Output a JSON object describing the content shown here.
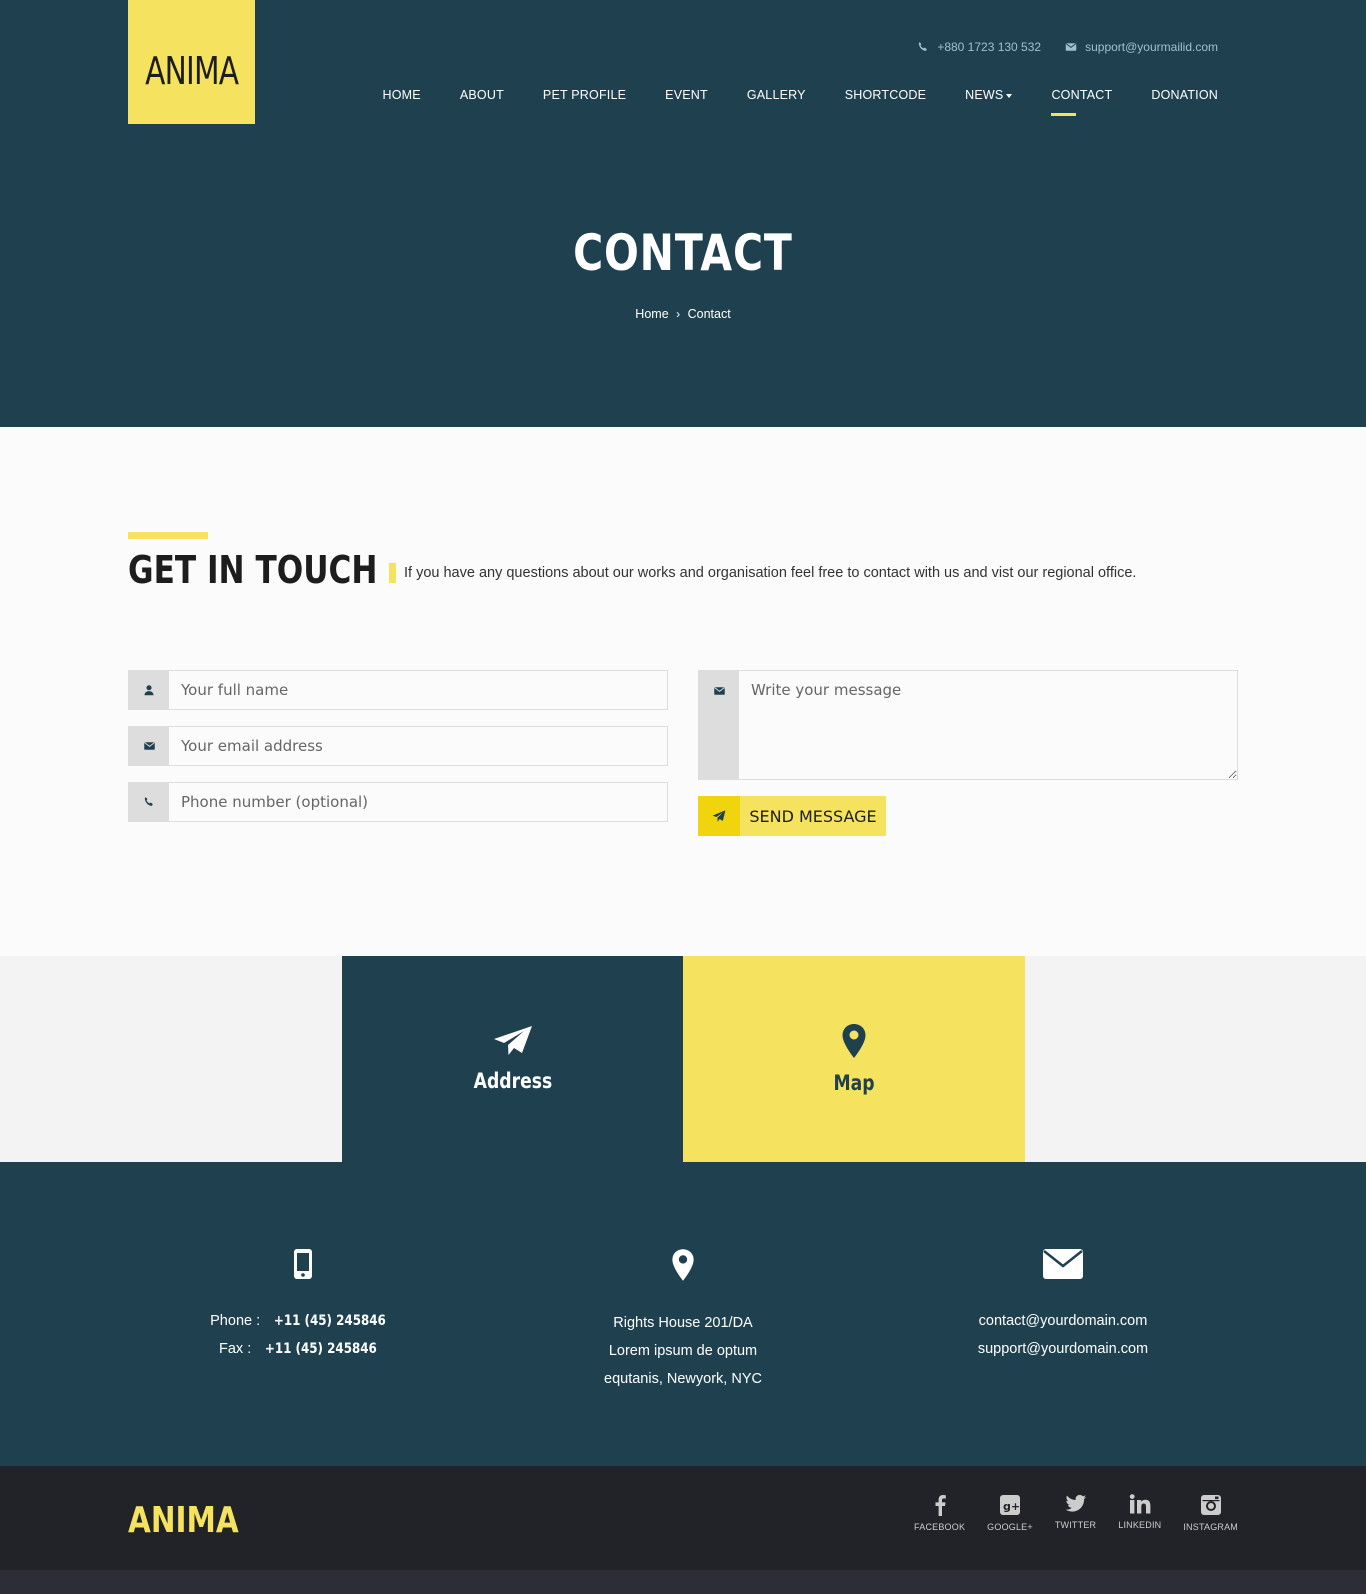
{
  "brand": {
    "logo": "ANIMA",
    "footer_logo": "ANIMA"
  },
  "topbar": {
    "phone": "+880 1723 130 532",
    "email": "support@yourmailid.com"
  },
  "nav": {
    "items": [
      "HOME",
      "ABOUT",
      "PET PROFILE",
      "EVENT",
      "GALLERY",
      "SHORTCODE",
      "NEWS",
      "CONTACT",
      "DONATION"
    ],
    "active": "CONTACT"
  },
  "hero": {
    "title": "CONTACT",
    "breadcrumb_home": "Home",
    "breadcrumb_sep": "›",
    "breadcrumb_current": "Contact"
  },
  "get_in_touch": {
    "title": "GET IN TOUCH",
    "description": "If you have any questions about our works and organisation feel free to contact with us and vist our regional office."
  },
  "form": {
    "name_placeholder": "Your full name",
    "email_placeholder": "Your email address",
    "phone_placeholder": "Phone number (optional)",
    "message_placeholder": "Write your message",
    "send_label": "SEND MESSAGE"
  },
  "tabs": {
    "address": "Address",
    "map": "Map"
  },
  "contact_info": {
    "phone_label": "Phone : ",
    "phone": "+11 (45) 245846",
    "fax_label": "Fax : ",
    "fax": "+11 (45) 245846",
    "address_line1": "Rights House 201/DA",
    "address_line2": "Lorem ipsum de optum",
    "address_line3": "equtanis, Newyork, NYC",
    "email1": "contact@yourdomain.com",
    "email2": "support@yourdomain.com"
  },
  "social": [
    "FACEBOOK",
    "GOOGLE+",
    "TWITTER",
    "LINKEDIN",
    "INSTAGRAM"
  ],
  "colors": {
    "primary": "#1f414f",
    "accent": "#f5e35f",
    "footer": "#222329",
    "light": "#fbfbfb"
  }
}
